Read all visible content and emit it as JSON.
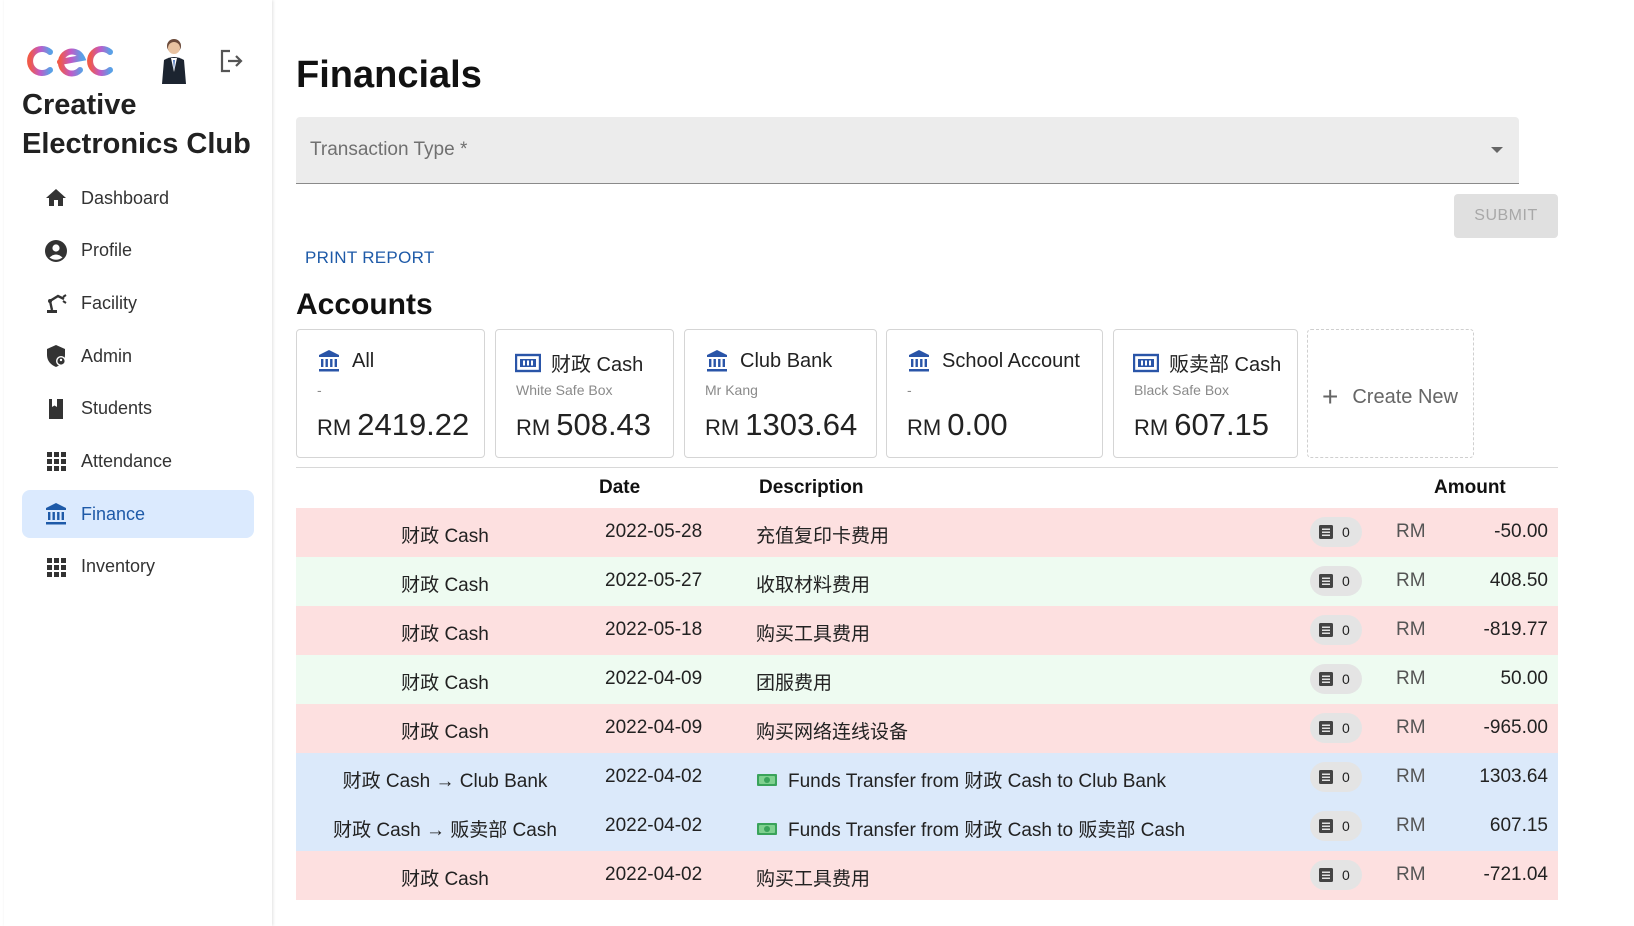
{
  "app": {
    "club_name": "Creative Electronics Club",
    "logo_text": "cec"
  },
  "sidebar": {
    "items": [
      {
        "label": "Dashboard",
        "icon": "home-icon",
        "active": false
      },
      {
        "label": "Profile",
        "icon": "account-circle-icon",
        "active": false
      },
      {
        "label": "Facility",
        "icon": "robot-arm-icon",
        "active": false
      },
      {
        "label": "Admin",
        "icon": "shield-account-icon",
        "active": false
      },
      {
        "label": "Students",
        "icon": "book-icon",
        "active": false
      },
      {
        "label": "Attendance",
        "icon": "grid-icon",
        "active": false
      },
      {
        "label": "Finance",
        "icon": "bank-icon",
        "active": true
      },
      {
        "label": "Inventory",
        "icon": "grid-icon",
        "active": false
      }
    ]
  },
  "main": {
    "title": "Financials",
    "transaction_type_placeholder": "Transaction Type *",
    "submit_label": "SUBMIT",
    "print_report_label": "PRINT REPORT",
    "accounts_title": "Accounts",
    "create_new_label": "Create New",
    "accounts": [
      {
        "name": "All",
        "sub": "-",
        "currency": "RM",
        "balance": "2419.22",
        "icon": "bank-icon"
      },
      {
        "name": "财政 Cash",
        "sub": "White Safe Box",
        "currency": "RM",
        "balance": "508.43",
        "icon": "cash-icon"
      },
      {
        "name": "Club Bank",
        "sub": "Mr Kang",
        "currency": "RM",
        "balance": "1303.64",
        "icon": "bank-icon"
      },
      {
        "name": "School Account",
        "sub": "-",
        "currency": "RM",
        "balance": "0.00",
        "icon": "bank-icon"
      },
      {
        "name": "贩卖部 Cash",
        "sub": "Black Safe Box",
        "currency": "RM",
        "balance": "607.15",
        "icon": "cash-icon"
      }
    ],
    "table": {
      "headers": {
        "date": "Date",
        "description": "Description",
        "amount": "Amount"
      },
      "rows": [
        {
          "account": "财政 Cash",
          "date": "2022-05-28",
          "description": "充值复印卡费用",
          "attachments": "0",
          "currency": "RM",
          "amount": "-50.00",
          "kind": "neg",
          "transfer": false
        },
        {
          "account": "财政 Cash",
          "date": "2022-05-27",
          "description": "收取材料费用",
          "attachments": "0",
          "currency": "RM",
          "amount": "408.50",
          "kind": "pos",
          "transfer": false
        },
        {
          "account": "财政 Cash",
          "date": "2022-05-18",
          "description": "购买工具费用",
          "attachments": "0",
          "currency": "RM",
          "amount": "-819.77",
          "kind": "neg",
          "transfer": false
        },
        {
          "account": "财政 Cash",
          "date": "2022-04-09",
          "description": "团服费用",
          "attachments": "0",
          "currency": "RM",
          "amount": "50.00",
          "kind": "pos",
          "transfer": false
        },
        {
          "account": "财政 Cash",
          "date": "2022-04-09",
          "description": "购买网络连线设备",
          "attachments": "0",
          "currency": "RM",
          "amount": "-965.00",
          "kind": "neg",
          "transfer": false
        },
        {
          "account": "财政 Cash → Club Bank",
          "date": "2022-04-02",
          "description": "Funds Transfer from 财政 Cash to Club Bank",
          "attachments": "0",
          "currency": "RM",
          "amount": "1303.64",
          "kind": "trf",
          "transfer": true
        },
        {
          "account": "财政 Cash → 贩卖部 Cash",
          "date": "2022-04-02",
          "description": "Funds Transfer from 财政 Cash to 贩卖部 Cash",
          "attachments": "0",
          "currency": "RM",
          "amount": "607.15",
          "kind": "trf",
          "transfer": true
        },
        {
          "account": "财政 Cash",
          "date": "2022-04-02",
          "description": "购买工具费用",
          "attachments": "0",
          "currency": "RM",
          "amount": "-721.04",
          "kind": "neg",
          "transfer": false
        }
      ]
    }
  },
  "colors": {
    "accent": "#1e5aa8",
    "active_bg": "#dbeafe",
    "negative_row": "#fde0e0",
    "positive_row": "#eefbf1",
    "transfer_row": "#dbe9fa"
  }
}
